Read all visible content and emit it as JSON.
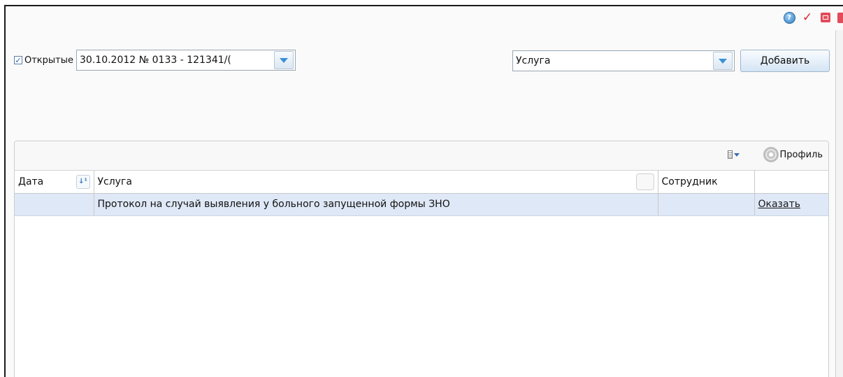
{
  "filter": {
    "open_checked": true,
    "open_label": "Открытые",
    "case_value": "30.10.2012 № 0133 - 121341/(",
    "service_value": "Услуга",
    "add_label": "Добавить"
  },
  "toolbar": {
    "profile_label": "Профиль"
  },
  "table": {
    "columns": [
      "Дата",
      "Услуга",
      "Сотрудник",
      ""
    ],
    "rows": [
      {
        "date": "",
        "service": "Протокол на случай выявления у больного запущенной формы ЗНО",
        "employee": "",
        "action": "Оказать"
      }
    ]
  },
  "colors": {
    "accent": "#3b8fd8",
    "row_selected": "#dfe8f6",
    "window_control": "#e24b5a"
  },
  "icons": [
    "help-icon",
    "checkmark-icon",
    "minimize-icon",
    "close-icon",
    "dropdown-arrow-icon",
    "columns-icon",
    "gear-icon",
    "sort-icon"
  ]
}
